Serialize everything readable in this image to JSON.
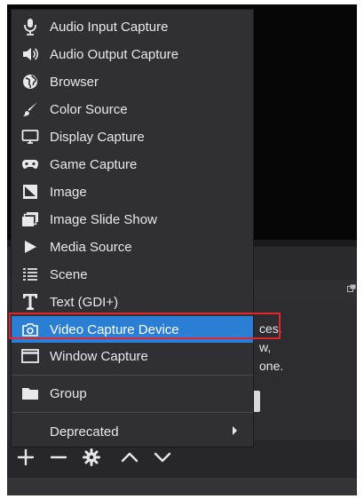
{
  "background": {
    "info_lines": [
      "ces.",
      "w,",
      "one."
    ],
    "toolbar": {
      "add_icon": "plus-icon",
      "remove_icon": "minus-icon",
      "settings_icon": "gear-icon",
      "up_icon": "chevron-up-icon",
      "down_icon": "chevron-down-icon"
    }
  },
  "menu": {
    "items": [
      {
        "label": "Audio Input Capture",
        "icon": "microphone-icon"
      },
      {
        "label": "Audio Output Capture",
        "icon": "speaker-icon"
      },
      {
        "label": "Browser",
        "icon": "globe-icon"
      },
      {
        "label": "Color Source",
        "icon": "paintbrush-icon"
      },
      {
        "label": "Display Capture",
        "icon": "monitor-icon"
      },
      {
        "label": "Game Capture",
        "icon": "gamepad-icon"
      },
      {
        "label": "Image",
        "icon": "image-icon"
      },
      {
        "label": "Image Slide Show",
        "icon": "slideshow-icon"
      },
      {
        "label": "Media Source",
        "icon": "play-icon"
      },
      {
        "label": "Scene",
        "icon": "list-icon"
      },
      {
        "label": "Text (GDI+)",
        "icon": "text-icon"
      },
      {
        "label": "Video Capture Device",
        "icon": "camera-icon",
        "selected": true
      },
      {
        "label": "Window Capture",
        "icon": "window-icon"
      },
      {
        "label": "Group",
        "icon": "folder-icon"
      },
      {
        "label": "Deprecated",
        "icon": "",
        "submenu": true
      }
    ]
  },
  "colors": {
    "menu_bg": "#2f2f34",
    "selected_bg": "#2a7fd4",
    "highlight_border": "#e0262b",
    "text": "#e9e9ec"
  }
}
